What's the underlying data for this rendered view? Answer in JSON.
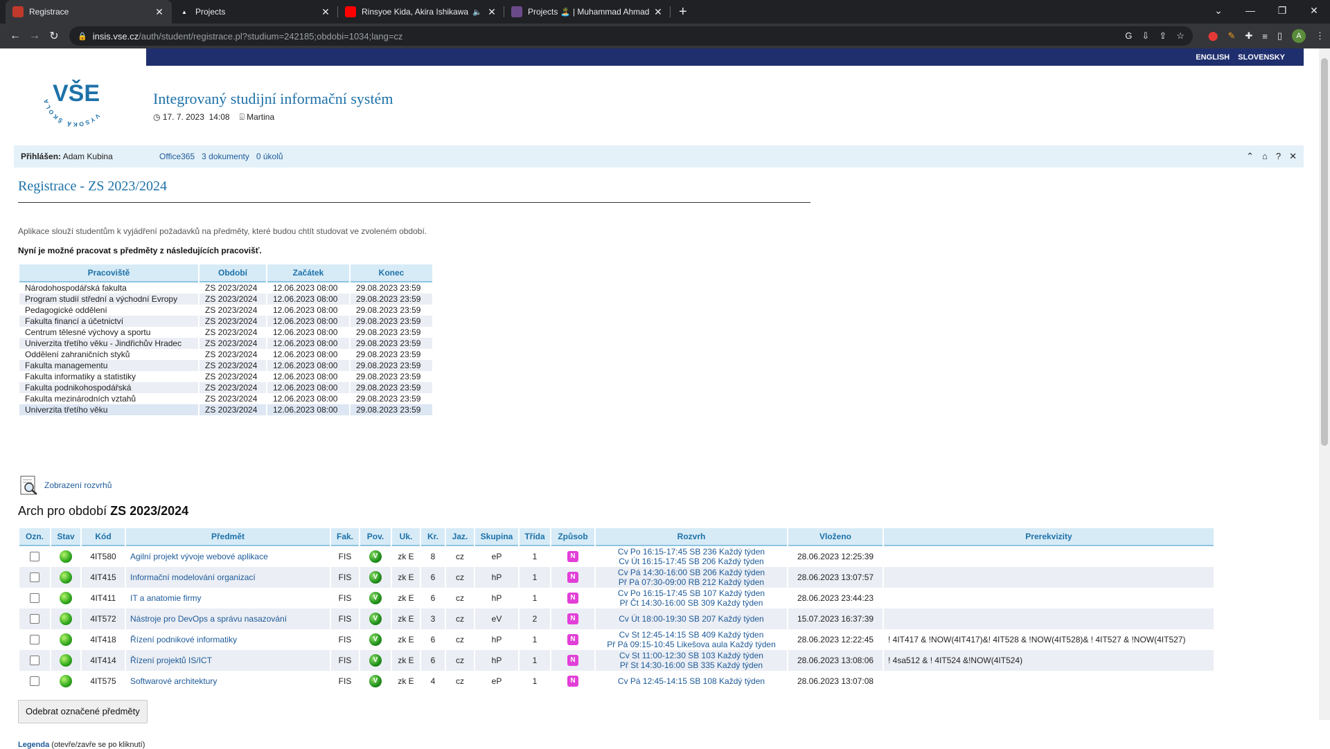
{
  "browser": {
    "tabs": [
      {
        "title": "Registrace",
        "favicon": "isis",
        "color": "#c0392b"
      },
      {
        "title": "Projects",
        "favicon": "A",
        "color": "#ffffff"
      },
      {
        "title": "Rinsyoe Kida, Akira Ishikawa",
        "favicon": "yt",
        "color": "#ff0000"
      },
      {
        "title": "Projects 🏝️ | Muhammad Ahmad",
        "favicon": "img",
        "color": "#6b4a8a"
      }
    ],
    "url_host": "insis.vse.cz",
    "url_path": "/auth/student/registrace.pl?studium=242185;obdobi=1034;lang=cz",
    "avatar_letter": "A"
  },
  "header": {
    "lang_en": "ENGLISH",
    "lang_sk": "SLOVENSKY",
    "logo_text": "VŠE",
    "logo_ring": "VYSOKÁ ŠKOLA EKONOMICKÁ V PRAZE",
    "system_title": "Integrovaný studijní informační systém",
    "date": "17. 7. 2023",
    "time": "14:08",
    "nameday": "Martina"
  },
  "userbar": {
    "logged_label": "Přihlášen:",
    "user": "Adam Kubina",
    "links": [
      "Office365",
      "3 dokumenty",
      "0 úkolů"
    ]
  },
  "main": {
    "title": "Registrace - ZS 2023/2024",
    "intro": "Aplikace slouží studentům k vyjádření požadavků na předměty, které budou chtít studovat ve zvoleném období.",
    "intro2": "Nyní je možné pracovat s předměty z následujících pracovišť.",
    "prac_headers": [
      "Pracoviště",
      "Období",
      "Začátek",
      "Konec"
    ],
    "prac_rows": [
      [
        "Národohospodářská fakulta",
        "ZS 2023/2024",
        "12.06.2023 08:00",
        "29.08.2023 23:59"
      ],
      [
        "Program studií střední a východní Evropy",
        "ZS 2023/2024",
        "12.06.2023 08:00",
        "29.08.2023 23:59"
      ],
      [
        "Pedagogické oddělení",
        "ZS 2023/2024",
        "12.06.2023 08:00",
        "29.08.2023 23:59"
      ],
      [
        "Fakulta financí a účetnictví",
        "ZS 2023/2024",
        "12.06.2023 08:00",
        "29.08.2023 23:59"
      ],
      [
        "Centrum tělesné výchovy a sportu",
        "ZS 2023/2024",
        "12.06.2023 08:00",
        "29.08.2023 23:59"
      ],
      [
        "Univerzita třetího věku - Jindřichův Hradec",
        "ZS 2023/2024",
        "12.06.2023 08:00",
        "29.08.2023 23:59"
      ],
      [
        "Oddělení zahraničních styků",
        "ZS 2023/2024",
        "12.06.2023 08:00",
        "29.08.2023 23:59"
      ],
      [
        "Fakulta managementu",
        "ZS 2023/2024",
        "12.06.2023 08:00",
        "29.08.2023 23:59"
      ],
      [
        "Fakulta informatiky a statistiky",
        "ZS 2023/2024",
        "12.06.2023 08:00",
        "29.08.2023 23:59"
      ],
      [
        "Fakulta podnikohospodářská",
        "ZS 2023/2024",
        "12.06.2023 08:00",
        "29.08.2023 23:59"
      ],
      [
        "Fakulta mezinárodních vztahů",
        "ZS 2023/2024",
        "12.06.2023 08:00",
        "29.08.2023 23:59"
      ],
      [
        "Univerzita třetího věku",
        "ZS 2023/2024",
        "12.06.2023 08:00",
        "29.08.2023 23:59"
      ]
    ],
    "rozvrh_link": "Zobrazení rozvrhů",
    "arch_title_prefix": "Arch pro období ",
    "arch_title_period": "ZS 2023/2024",
    "arch_headers": [
      "Ozn.",
      "Stav",
      "Kód",
      "Předmět",
      "Fak.",
      "Pov.",
      "Uk.",
      "Kr.",
      "Jaz.",
      "Skupina",
      "Třída",
      "Způsob",
      "Rozvrh",
      "Vloženo",
      "Prerekvizity"
    ],
    "arch_rows": [
      {
        "code": "4IT580",
        "name": "Agilní projekt vývoje webové aplikace",
        "fak": "FIS",
        "pov": "V",
        "uk": "zk E",
        "kr": "8",
        "jaz": "cz",
        "skup": "eP",
        "trida": "1",
        "zpusob": "N",
        "rozvrh": [
          "Cv Po 16:15-17:45 SB 236 Každý týden",
          "Cv Út 16:15-17:45 SB 206 Každý týden"
        ],
        "vlozeno": "28.06.2023 12:25:39",
        "prereq": ""
      },
      {
        "code": "4IT415",
        "name": "Informační modelování organizací",
        "fak": "FIS",
        "pov": "V",
        "uk": "zk E",
        "kr": "6",
        "jaz": "cz",
        "skup": "hP",
        "trida": "1",
        "zpusob": "N",
        "rozvrh": [
          "Cv Pá 14:30-16:00 SB 206 Každý týden",
          "Př Pá 07:30-09:00 RB 212 Každý týden"
        ],
        "vlozeno": "28.06.2023 13:07:57",
        "prereq": ""
      },
      {
        "code": "4IT411",
        "name": "IT a anatomie firmy",
        "fak": "FIS",
        "pov": "V",
        "uk": "zk E",
        "kr": "6",
        "jaz": "cz",
        "skup": "hP",
        "trida": "1",
        "zpusob": "N",
        "rozvrh": [
          "Cv Po 16:15-17:45 SB 107 Každý týden",
          "Př Čt 14:30-16:00 SB 309 Každý týden"
        ],
        "vlozeno": "28.06.2023 23:44:23",
        "prereq": ""
      },
      {
        "code": "4IT572",
        "name": "Nástroje pro DevOps a správu nasazování",
        "fak": "FIS",
        "pov": "V",
        "uk": "zk E",
        "kr": "3",
        "jaz": "cz",
        "skup": "eV",
        "trida": "2",
        "zpusob": "N",
        "rozvrh": [
          "Cv Út 18:00-19:30 SB 207 Každý týden"
        ],
        "vlozeno": "15.07.2023 16:37:39",
        "prereq": ""
      },
      {
        "code": "4IT418",
        "name": "Řízení podnikové informatiky",
        "fak": "FIS",
        "pov": "V",
        "uk": "zk E",
        "kr": "6",
        "jaz": "cz",
        "skup": "hP",
        "trida": "1",
        "zpusob": "N",
        "rozvrh": [
          "Cv St 12:45-14:15 SB 409 Každý týden",
          "Př Pá 09:15-10:45 Likešova aula Každý týden"
        ],
        "vlozeno": "28.06.2023 12:22:45",
        "prereq": "! 4IT417 & !NOW(4IT417)&! 4IT528 & !NOW(4IT528)& ! 4IT527 & !NOW(4IT527)"
      },
      {
        "code": "4IT414",
        "name": "Řízení projektů IS/ICT",
        "fak": "FIS",
        "pov": "V",
        "uk": "zk E",
        "kr": "6",
        "jaz": "cz",
        "skup": "hP",
        "trida": "1",
        "zpusob": "N",
        "rozvrh": [
          "Cv St 11:00-12:30 SB 103 Každý týden",
          "Př St 14:30-16:00 SB 335 Každý týden"
        ],
        "vlozeno": "28.06.2023 13:08:06",
        "prereq": "! 4sa512 & ! 4IT524 &!NOW(4IT524)"
      },
      {
        "code": "4IT575",
        "name": "Softwarové architektury",
        "fak": "FIS",
        "pov": "V",
        "uk": "zk E",
        "kr": "4",
        "jaz": "cz",
        "skup": "eP",
        "trida": "1",
        "zpusob": "N",
        "rozvrh": [
          "Cv Pá 12:45-14:15 SB 108 Každý týden"
        ],
        "vlozeno": "28.06.2023 13:07:08",
        "prereq": ""
      }
    ],
    "remove_button": "Odebrat označené předměty",
    "legenda_link": "Legenda",
    "legenda_note": " (otevře/zavře se po kliknutí)"
  }
}
